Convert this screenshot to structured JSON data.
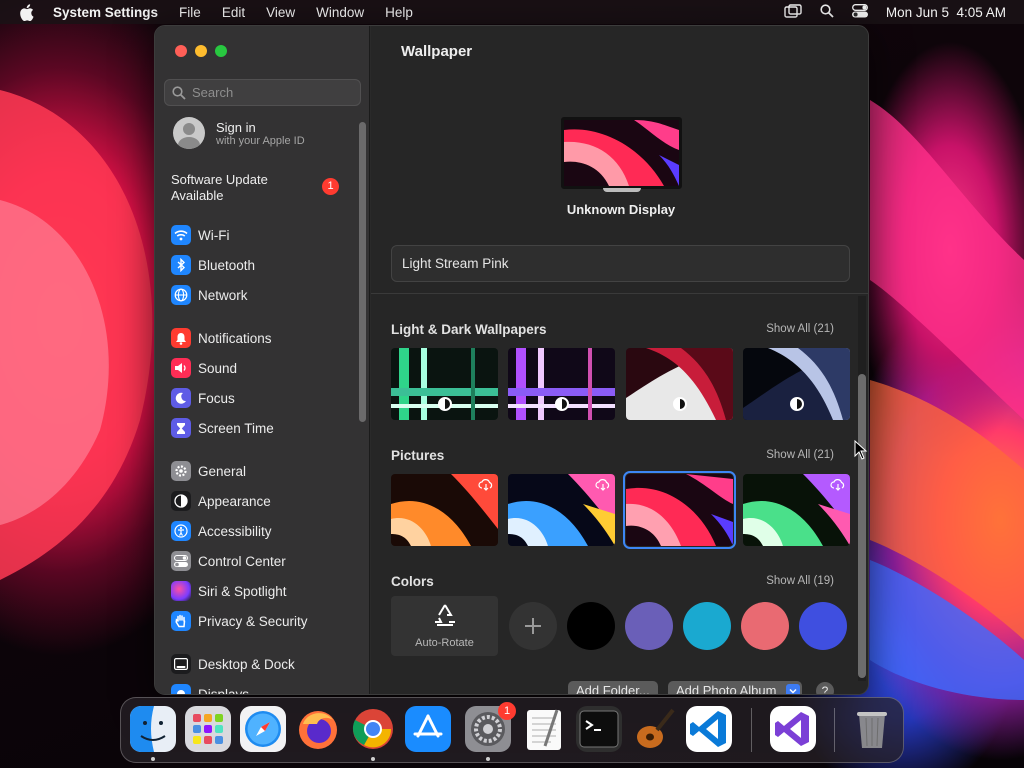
{
  "menubar": {
    "app_name": "System Settings",
    "items": [
      "File",
      "Edit",
      "View",
      "Window",
      "Help"
    ],
    "clock": "Mon Jun 5  4:05 AM"
  },
  "sidebar": {
    "search_placeholder": "Search",
    "signin": {
      "title": "Sign in",
      "subtitle": "with your Apple ID"
    },
    "software_update": {
      "label": "Software Update Available",
      "badge": "1"
    },
    "items": [
      {
        "label": "Wi-Fi",
        "icon": "wifi-icon",
        "color": "#1f86ff"
      },
      {
        "label": "Bluetooth",
        "icon": "bluetooth-icon",
        "color": "#1f86ff"
      },
      {
        "label": "Network",
        "icon": "globe-icon",
        "color": "#1f86ff"
      },
      {
        "label": "Notifications",
        "icon": "bell-icon",
        "color": "#ff3b30"
      },
      {
        "label": "Sound",
        "icon": "speaker-icon",
        "color": "#ff2d55"
      },
      {
        "label": "Focus",
        "icon": "moon-icon",
        "color": "#5e5ce6"
      },
      {
        "label": "Screen Time",
        "icon": "hourglass-icon",
        "color": "#5e5ce6"
      },
      {
        "label": "General",
        "icon": "gear-icon",
        "color": "#8e8e93"
      },
      {
        "label": "Appearance",
        "icon": "appearance-icon",
        "color": "#1c1c1e"
      },
      {
        "label": "Accessibility",
        "icon": "accessibility-icon",
        "color": "#1f86ff"
      },
      {
        "label": "Control Center",
        "icon": "control-center-icon",
        "color": "#8e8e93"
      },
      {
        "label": "Siri & Spotlight",
        "icon": "siri-icon",
        "color": "#b52fd3"
      },
      {
        "label": "Privacy & Security",
        "icon": "hand-icon",
        "color": "#1f86ff"
      },
      {
        "label": "Desktop & Dock",
        "icon": "dock-icon",
        "color": "#1c1c1e"
      },
      {
        "label": "Displays",
        "icon": "display-icon",
        "color": "#1f86ff"
      }
    ]
  },
  "main": {
    "title": "Wallpaper",
    "display_name": "Unknown Display",
    "wallpaper_name": "Light Stream Pink",
    "sections": [
      {
        "title": "Light & Dark Wallpapers",
        "show_all": "Show All (21)"
      },
      {
        "title": "Pictures",
        "show_all": "Show All (21)"
      },
      {
        "title": "Colors",
        "show_all": "Show All (19)"
      }
    ],
    "auto_rotate_label": "Auto-Rotate",
    "color_swatches": [
      "#000000",
      "#6a5fb8",
      "#1aa9d0",
      "#e96a72",
      "#3f4fe0"
    ],
    "buttons": {
      "add_folder": "Add Folder...",
      "add_photo_album": "Add Photo Album",
      "help": "?"
    }
  },
  "dock": {
    "apps": [
      {
        "name": "Finder",
        "running": true
      },
      {
        "name": "Launchpad",
        "running": false
      },
      {
        "name": "Safari",
        "running": false
      },
      {
        "name": "Firefox",
        "running": false
      },
      {
        "name": "Chrome",
        "running": true
      },
      {
        "name": "App Store",
        "running": false
      },
      {
        "name": "System Settings",
        "running": true,
        "badge": "1"
      },
      {
        "name": "TextEdit",
        "running": false
      },
      {
        "name": "Terminal",
        "running": false
      },
      {
        "name": "GarageBand",
        "running": false
      },
      {
        "name": "Visual Studio Code",
        "running": false
      },
      {
        "name": "Visual Studio",
        "running": false
      },
      {
        "name": "Trash",
        "running": false
      }
    ]
  }
}
